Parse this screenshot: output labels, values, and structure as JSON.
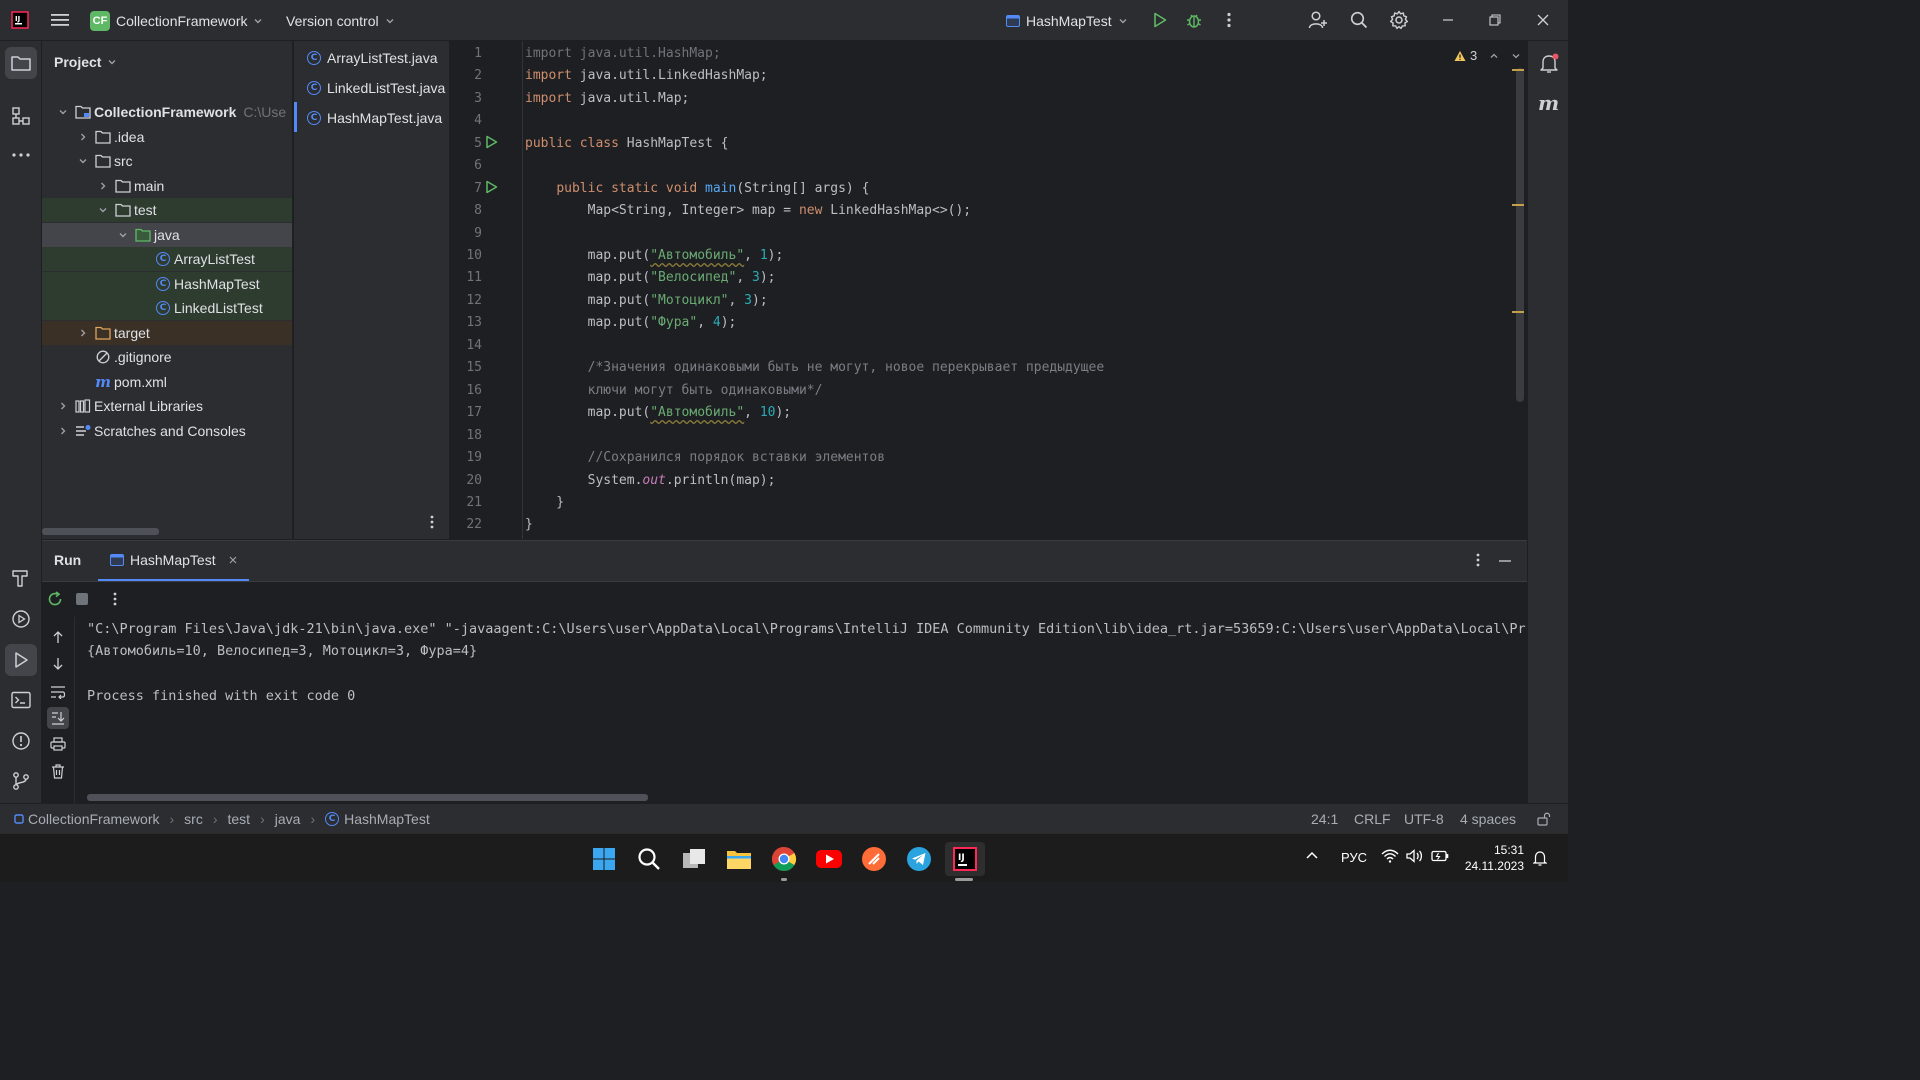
{
  "titlebar": {
    "project_badge": "CF",
    "project_name": "CollectionFramework",
    "version_control": "Version control",
    "run_config": "HashMapTest"
  },
  "project_panel": {
    "title": "Project",
    "tree": [
      {
        "label": "CollectionFramework",
        "suffix": "C:\\Use",
        "depth": 0,
        "kind": "module",
        "expanded": true
      },
      {
        "label": ".idea",
        "depth": 1,
        "kind": "folder",
        "expanded": false
      },
      {
        "label": "src",
        "depth": 1,
        "kind": "folder",
        "expanded": true
      },
      {
        "label": "main",
        "depth": 2,
        "kind": "folder",
        "expanded": false
      },
      {
        "label": "test",
        "depth": 2,
        "kind": "folder",
        "expanded": true
      },
      {
        "label": "java",
        "depth": 3,
        "kind": "folder-green",
        "expanded": true,
        "selected": true
      },
      {
        "label": "ArrayListTest",
        "depth": 4,
        "kind": "class"
      },
      {
        "label": "HashMapTest",
        "depth": 4,
        "kind": "class"
      },
      {
        "label": "LinkedListTest",
        "depth": 4,
        "kind": "class"
      },
      {
        "label": "target",
        "depth": 1,
        "kind": "folder-orange",
        "expanded": false
      },
      {
        "label": ".gitignore",
        "depth": 1,
        "kind": "ignore"
      },
      {
        "label": "pom.xml",
        "depth": 1,
        "kind": "maven"
      },
      {
        "label": "External Libraries",
        "depth": 0,
        "kind": "library",
        "expanded": false
      },
      {
        "label": "Scratches and Consoles",
        "depth": 0,
        "kind": "scratch",
        "expanded": false
      }
    ]
  },
  "open_files": [
    "ArrayListTest.java",
    "LinkedListTest.java",
    "HashMapTest.java"
  ],
  "editor": {
    "warnings_count": "3",
    "lines": [
      "1",
      "2",
      "3",
      "4",
      "5",
      "6",
      "7",
      "8",
      "9",
      "10",
      "11",
      "12",
      "13",
      "14",
      "15",
      "16",
      "17",
      "18",
      "19",
      "20",
      "21",
      "22"
    ]
  },
  "run_panel": {
    "title": "Run",
    "tab": "HashMapTest",
    "output": [
      "\"C:\\Program Files\\Java\\jdk-21\\bin\\java.exe\" \"-javaagent:C:\\Users\\user\\AppData\\Local\\Programs\\IntelliJ IDEA Community Edition\\lib\\idea_rt.jar=53659:C:\\Users\\user\\AppData\\Local\\Pr",
      "{Автомобиль=10, Велосипед=3, Мотоцикл=3, Фура=4}",
      "",
      "Process finished with exit code 0"
    ]
  },
  "statusbar": {
    "breadcrumb": [
      "CollectionFramework",
      "src",
      "test",
      "java",
      "HashMapTest"
    ],
    "position": "24:1",
    "line_sep": "CRLF",
    "encoding": "UTF-8",
    "indent": "4 spaces"
  },
  "taskbar": {
    "lang": "РУС",
    "time": "15:31",
    "date": "24.11.2023"
  },
  "colors": {
    "accent": "#548af7",
    "run_green": "#5fb865",
    "selection": "#43454a"
  }
}
